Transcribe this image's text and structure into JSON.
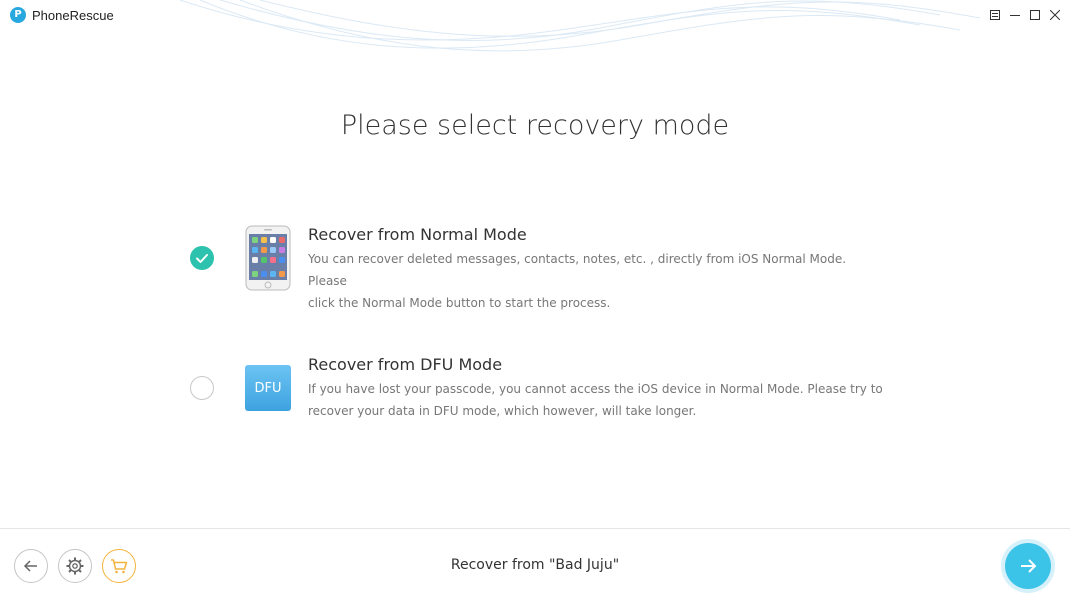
{
  "app": {
    "title": "PhoneRescue",
    "logo_letter": "P"
  },
  "window_controls": [
    "menu-icon",
    "minimize-icon",
    "maximize-icon",
    "close-icon"
  ],
  "main": {
    "title": "Please select recovery mode",
    "options": [
      {
        "title": "Recover from Normal Mode",
        "description_line1": "You can recover deleted messages, contacts, notes, etc. , directly from iOS Normal Mode. Please",
        "description_line2": "click the Normal Mode button to start the process.",
        "selected": true,
        "icon": "iphone-icon"
      },
      {
        "title": "Recover from DFU Mode",
        "description_line1": "If you have lost your passcode, you cannot access the iOS device in Normal Mode. Please try to",
        "description_line2": "recover your data in DFU mode, which however, will take longer.",
        "selected": false,
        "icon_label": "DFU"
      }
    ]
  },
  "footer": {
    "status_text": "Recover from \"Bad Juju\"",
    "buttons": [
      "back-icon",
      "settings-icon",
      "cart-icon"
    ],
    "next_icon": "arrow-right-icon"
  },
  "colors": {
    "accent_teal": "#2cc2ad",
    "accent_blue": "#3cc3e8",
    "cart_orange": "#f2b33d"
  }
}
